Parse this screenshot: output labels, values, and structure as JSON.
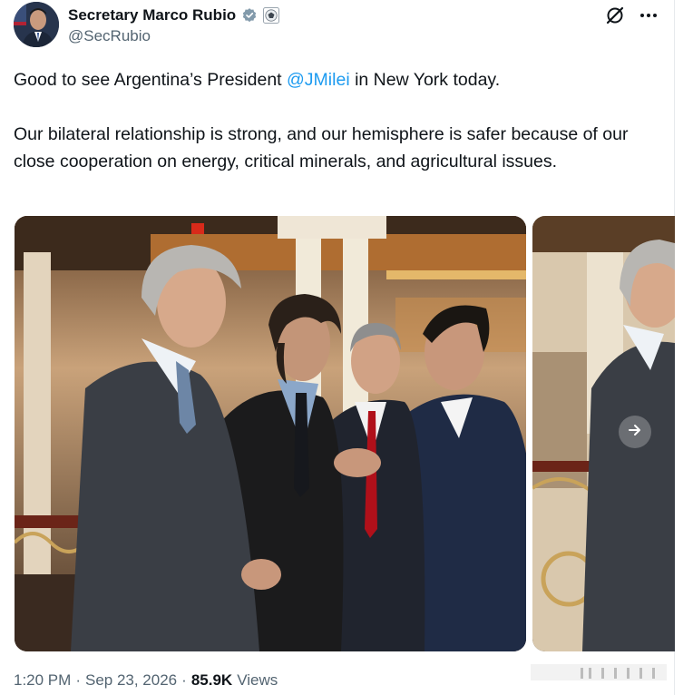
{
  "header": {
    "display_name": "Secretary Marco Rubio",
    "handle": "@SecRubio",
    "icons": {
      "verified": "verified-badge-icon",
      "seal": "state-department-seal-icon",
      "grok": "grok-icon",
      "more": "more-icon"
    }
  },
  "tweet": {
    "para1_before": "Good to see Argentina’s President ",
    "para1_mention": "@JMilei",
    "para1_after": " in New York today.",
    "para2": "Our bilateral relationship is strong, and our hemisphere is safer because of our close cooperation on energy, critical minerals, and agricultural issues."
  },
  "footer": {
    "time": "1:20 PM",
    "date": "Sep 23, 2026",
    "views_count": "85.9K",
    "views_label": "Views"
  },
  "colors": {
    "link": "#1d9bf0",
    "verified": "#829aab",
    "muted": "#536471",
    "text": "#0f1419"
  }
}
